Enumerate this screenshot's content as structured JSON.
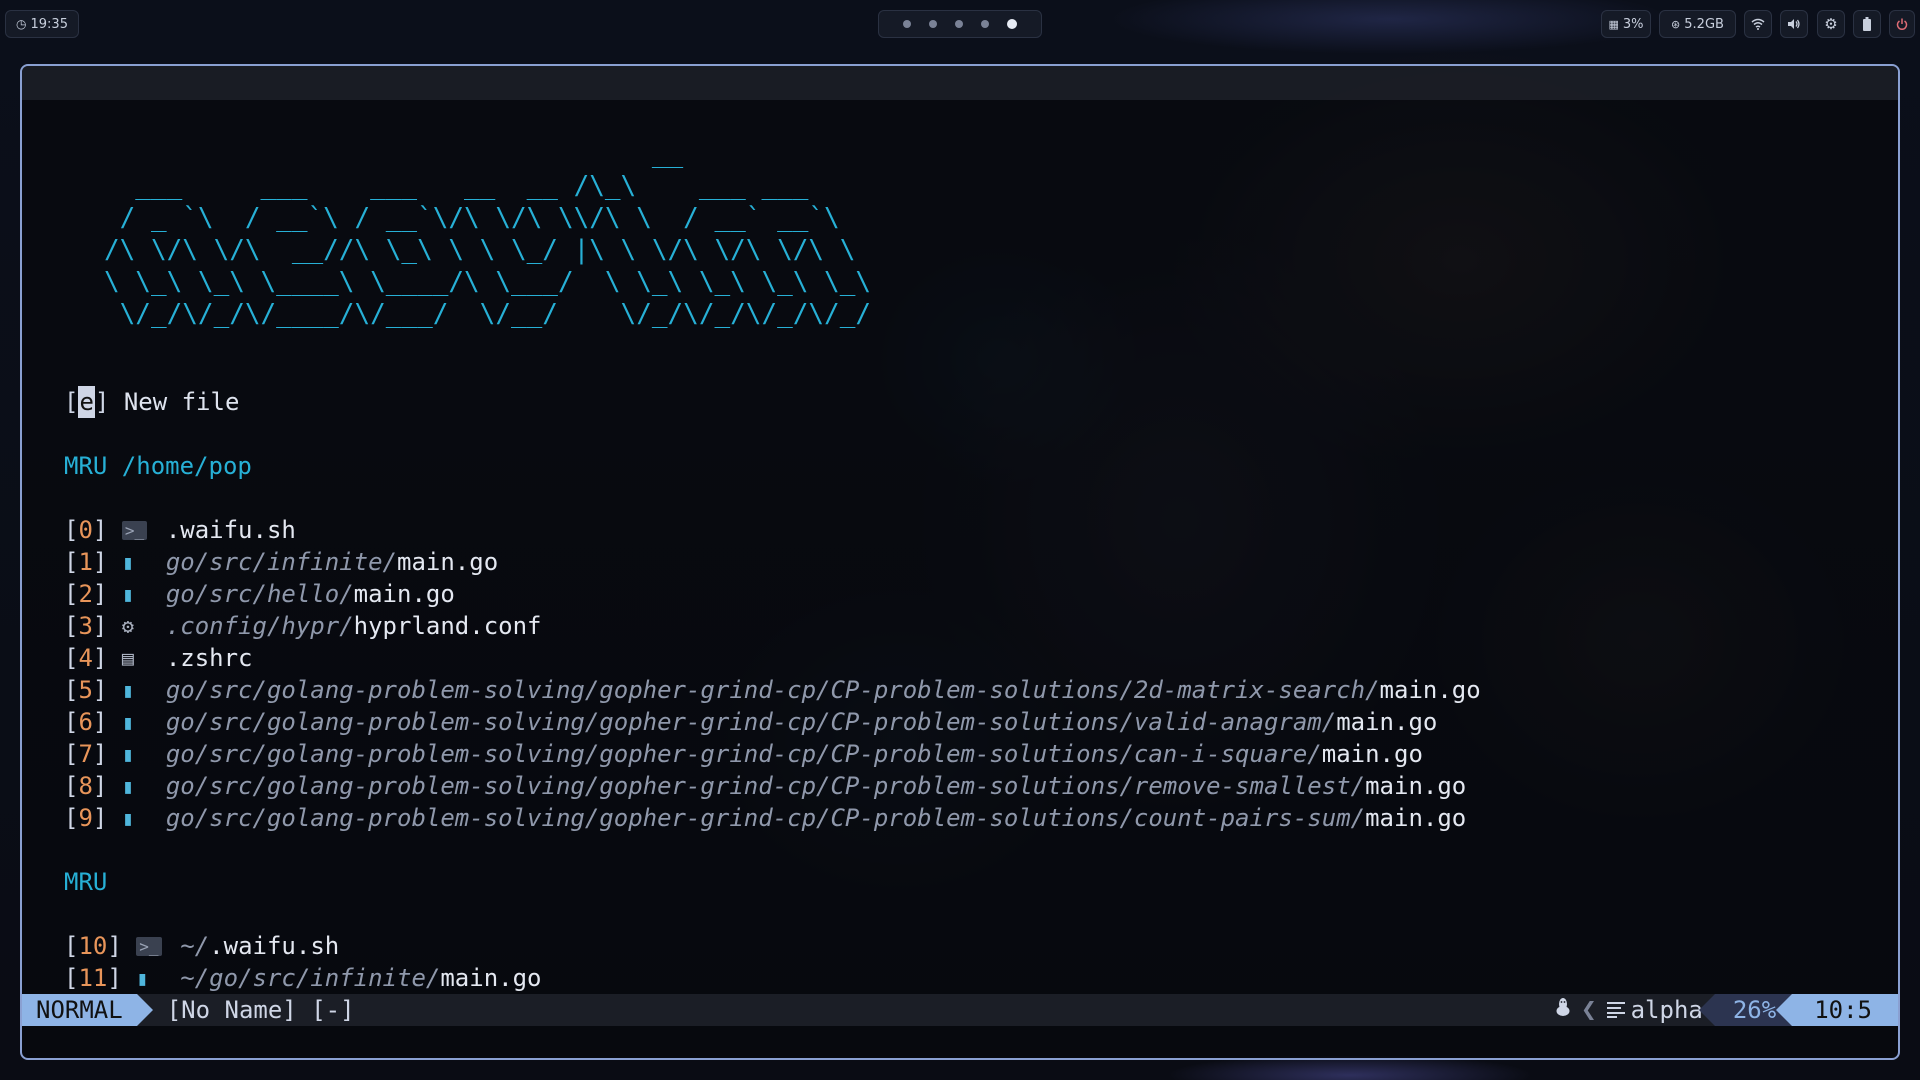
{
  "topbar": {
    "clock": {
      "icon": "clock-icon",
      "time": "19:35"
    },
    "workspaces": {
      "count": 5,
      "active_index": 4
    },
    "cpu": {
      "icon": "cpu-icon",
      "value": "3%"
    },
    "memory": {
      "icon": "memory-icon",
      "value": "5.2GB"
    },
    "icons": [
      "wifi-icon",
      "volume-icon",
      "gear-icon",
      "battery-icon",
      "power-icon"
    ]
  },
  "banner": {
    "ascii": "                                   __\n  ___     ___    ___   __  __ /\\_\\    ___ ___\n / _ `\\  / __`\\ / __`\\/\\ \\/\\ \\\\/\\ \\  / __` __`\\\n/\\ \\/\\ \\/\\  __//\\ \\_\\ \\ \\ \\_/ |\\ \\ \\/\\ \\/\\ \\/\\ \\\n\\ \\_\\ \\_\\ \\____\\ \\____/\\ \\___/  \\ \\_\\ \\_\\ \\_\\ \\_\\\n \\/_/\\/_/\\/____/\\/___/  \\/__/    \\/_/\\/_/\\/_/\\/_/"
  },
  "new_file": {
    "key": "e",
    "label": "New file"
  },
  "mru_local": {
    "header": "MRU /home/pop",
    "items": [
      {
        "index": "0",
        "icon": "terminal-icon",
        "dir": "",
        "file": ".waifu.sh"
      },
      {
        "index": "1",
        "icon": "go-gopher-icon",
        "dir": "go/src/infinite/",
        "file": "main.go"
      },
      {
        "index": "2",
        "icon": "go-gopher-icon",
        "dir": "go/src/hello/",
        "file": "main.go"
      },
      {
        "index": "3",
        "icon": "config-gear-icon",
        "dir": ".config/hypr/",
        "file": "hyprland.conf"
      },
      {
        "index": "4",
        "icon": "text-file-icon",
        "dir": "",
        "file": ".zshrc"
      },
      {
        "index": "5",
        "icon": "go-gopher-icon",
        "dir": "go/src/golang-problem-solving/gopher-grind-cp/CP-problem-solutions/2d-matrix-search/",
        "file": "main.go"
      },
      {
        "index": "6",
        "icon": "go-gopher-icon",
        "dir": "go/src/golang-problem-solving/gopher-grind-cp/CP-problem-solutions/valid-anagram/",
        "file": "main.go"
      },
      {
        "index": "7",
        "icon": "go-gopher-icon",
        "dir": "go/src/golang-problem-solving/gopher-grind-cp/CP-problem-solutions/can-i-square/",
        "file": "main.go"
      },
      {
        "index": "8",
        "icon": "go-gopher-icon",
        "dir": "go/src/golang-problem-solving/gopher-grind-cp/CP-problem-solutions/remove-smallest/",
        "file": "main.go"
      },
      {
        "index": "9",
        "icon": "go-gopher-icon",
        "dir": "go/src/golang-problem-solving/gopher-grind-cp/CP-problem-solutions/count-pairs-sum/",
        "file": "main.go"
      }
    ]
  },
  "mru_global": {
    "header": "MRU",
    "items": [
      {
        "index": "10",
        "icon": "terminal-icon",
        "dir": "~/",
        "file": ".waifu.sh"
      },
      {
        "index": "11",
        "icon": "go-gopher-icon",
        "dir": "~/go/src/infinite/",
        "file": "main.go"
      }
    ]
  },
  "statusline": {
    "mode": "NORMAL",
    "buffer": "[No Name] [-]",
    "os_icon": "linux-tux-icon",
    "filetype": "alpha",
    "percent": "26%",
    "position": "10:5"
  },
  "colors": {
    "accent_cyan": "#27b0d6",
    "index_orange": "#e8955a",
    "mode_blue": "#8eb4e6",
    "window_border": "#8aa0d2"
  }
}
